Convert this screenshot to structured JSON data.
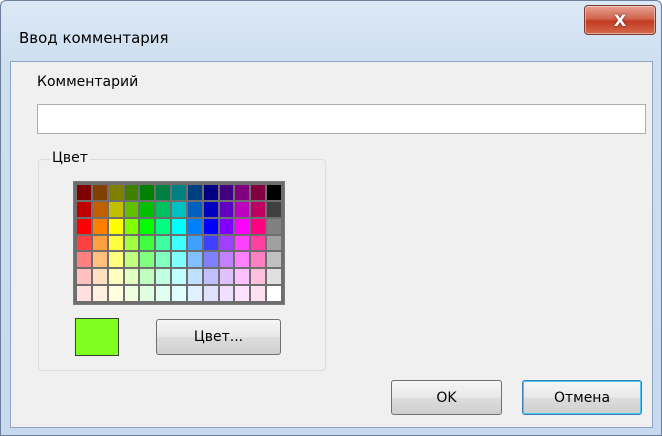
{
  "dialog": {
    "title": "Ввод комментария",
    "close_glyph": "X"
  },
  "comment": {
    "label": "Комментарий",
    "value": ""
  },
  "color_group": {
    "title": "Цвет",
    "selected_color": "#7fff1f",
    "button_label": "Цвет..."
  },
  "palette": [
    [
      "#800000",
      "#804000",
      "#808000",
      "#408000",
      "#008000",
      "#008040",
      "#008080",
      "#004080",
      "#000080",
      "#400080",
      "#800080",
      "#800040",
      "#000000"
    ],
    [
      "#c00000",
      "#c06000",
      "#c0c000",
      "#60c000",
      "#00c000",
      "#00c060",
      "#00c0c0",
      "#0060c0",
      "#0000c0",
      "#6000c0",
      "#c000c0",
      "#c00060",
      "#404040"
    ],
    [
      "#ff0000",
      "#ff8000",
      "#ffff00",
      "#80ff00",
      "#00ff00",
      "#00ff80",
      "#00ffff",
      "#0080ff",
      "#0000ff",
      "#8000ff",
      "#ff00ff",
      "#ff0080",
      "#808080"
    ],
    [
      "#ff4040",
      "#ffa040",
      "#ffff40",
      "#a0ff40",
      "#40ff40",
      "#40ffa0",
      "#40ffff",
      "#40a0ff",
      "#4040ff",
      "#a040ff",
      "#ff40ff",
      "#ff40a0",
      "#a0a0a0"
    ],
    [
      "#ff8080",
      "#ffc080",
      "#ffff80",
      "#c0ff80",
      "#80ff80",
      "#80ffc0",
      "#80ffff",
      "#80c0ff",
      "#8080ff",
      "#c080ff",
      "#ff80ff",
      "#ff80c0",
      "#c0c0c0"
    ],
    [
      "#ffc0c0",
      "#ffe0c0",
      "#ffffc0",
      "#e0ffc0",
      "#c0ffc0",
      "#c0ffe0",
      "#c0ffff",
      "#c0e0ff",
      "#c0c0ff",
      "#e0c0ff",
      "#ffc0ff",
      "#ffc0e0",
      "#e0e0e0"
    ],
    [
      "#ffe0e0",
      "#fff0e0",
      "#ffffe0",
      "#f0ffe0",
      "#e0ffe0",
      "#e0fff0",
      "#e0ffff",
      "#e0f0ff",
      "#e0e0ff",
      "#f0e0ff",
      "#ffe0ff",
      "#ffe0f0",
      "#ffffff"
    ]
  ],
  "buttons": {
    "ok": "OK",
    "cancel": "Отмена"
  }
}
